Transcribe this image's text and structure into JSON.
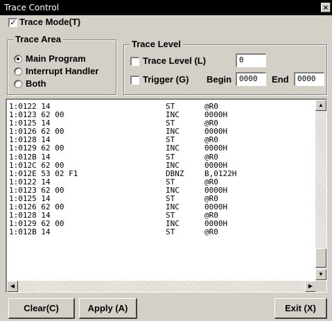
{
  "window": {
    "title": "Trace Control",
    "close_glyph": "×"
  },
  "trace_mode": {
    "label": "Trace Mode(T)",
    "checked": true,
    "check_glyph": "✓"
  },
  "trace_area": {
    "title": "Trace Area",
    "options": [
      {
        "label": "Main Program",
        "selected": true
      },
      {
        "label": "Interrupt Handler",
        "selected": false
      },
      {
        "label": "Both",
        "selected": false
      }
    ]
  },
  "trace_level": {
    "title": "Trace Level",
    "level_label": "Trace Level (L)",
    "level_checked": false,
    "level_value": "0",
    "trigger_label": "Trigger (G)",
    "trigger_checked": false,
    "begin_label": "Begin",
    "begin_value": "0000",
    "end_label": "End",
    "end_value": "0000"
  },
  "trace_rows": [
    {
      "addr": "1:0122 14",
      "op": "ST",
      "arg": "@R0"
    },
    {
      "addr": "1:0123 62 00",
      "op": "INC",
      "arg": "0000H"
    },
    {
      "addr": "1:0125 14",
      "op": "ST",
      "arg": "@R0"
    },
    {
      "addr": "1:0126 62 00",
      "op": "INC",
      "arg": "0000H"
    },
    {
      "addr": "1:0128 14",
      "op": "ST",
      "arg": "@R0"
    },
    {
      "addr": "1:0129 62 00",
      "op": "INC",
      "arg": "0000H"
    },
    {
      "addr": "1:012B 14",
      "op": "ST",
      "arg": "@R0"
    },
    {
      "addr": "1:012C 62 00",
      "op": "INC",
      "arg": "0000H"
    },
    {
      "addr": "1:012E 53 02 F1",
      "op": "DBNZ",
      "arg": "B,0122H"
    },
    {
      "addr": "1:0122 14",
      "op": "ST",
      "arg": "@R0"
    },
    {
      "addr": "1:0123 62 00",
      "op": "INC",
      "arg": "0000H"
    },
    {
      "addr": "1:0125 14",
      "op": "ST",
      "arg": "@R0"
    },
    {
      "addr": "1:0126 62 00",
      "op": "INC",
      "arg": "0000H"
    },
    {
      "addr": "1:0128 14",
      "op": "ST",
      "arg": "@R0"
    },
    {
      "addr": "1:0129 62 00",
      "op": "INC",
      "arg": "0000H"
    },
    {
      "addr": "1:012B 14",
      "op": "ST",
      "arg": "@R0"
    }
  ],
  "scroll": {
    "up": "▲",
    "down": "▼",
    "left": "◀",
    "right": "▶"
  },
  "buttons": {
    "clear": "Clear(C)",
    "apply": "Apply (A)",
    "exit": "Exit (X)"
  }
}
